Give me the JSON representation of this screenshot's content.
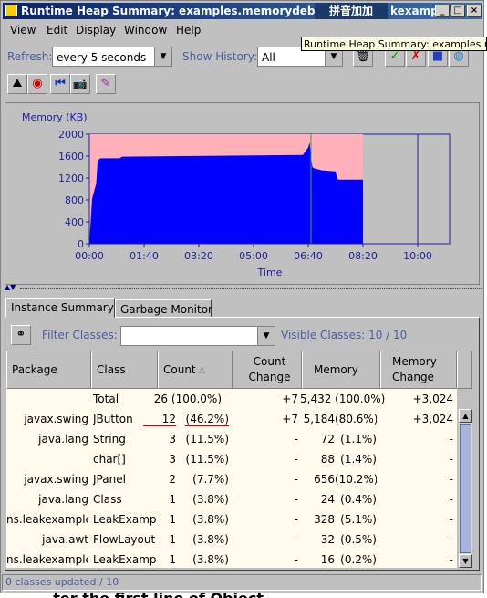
{
  "window": {
    "title": "Runtime Heap Summary: examples.memorydebugger.a",
    "title_tail": "kexamp..."
  },
  "ime_text": "拼音加加",
  "tooltip": "Runtime Heap Summary: examples.memor",
  "menu": [
    "View",
    "Edit",
    "Display",
    "Window",
    "Help"
  ],
  "toolbar": {
    "refresh_label": "Refresh:",
    "refresh_value": "every 5 seconds",
    "history_label": "Show History:",
    "history_value": "All"
  },
  "chart_data": {
    "type": "area",
    "ylabel": "Memory (KB)",
    "xlabel": "Time",
    "ylim": [
      0,
      2000
    ],
    "xlim_minutes": [
      0,
      12
    ],
    "yticks": [
      "0",
      "400",
      "800",
      "1200",
      "1600",
      "2000"
    ],
    "xticks": [
      "00:00",
      "01:40",
      "03:20",
      "05:00",
      "06:40",
      "08:20",
      "10:00"
    ],
    "series": [
      {
        "role": "total",
        "color": "#ffb0b8",
        "x": [
          0,
          10
        ],
        "values": [
          2000,
          2000
        ]
      },
      {
        "role": "used",
        "color": "#0000ff",
        "x": [
          0,
          0.1,
          0.25,
          0.3,
          0.35,
          0.4,
          1.1,
          1.2,
          7.8,
          8.0,
          8.05,
          8.1,
          8.15,
          8.2,
          8.5,
          9.0,
          9.05,
          9.1,
          10
        ],
        "values": [
          0,
          820,
          1100,
          1500,
          1540,
          1560,
          1560,
          1590,
          1620,
          1760,
          1850,
          1600,
          1400,
          1380,
          1340,
          1320,
          1200,
          1170,
          1170
        ]
      }
    ],
    "marker_x_minutes": 8.1,
    "grid": false
  },
  "tabs": [
    "Instance Summary",
    "Garbage Monitor"
  ],
  "filter": {
    "label": "Filter Classes:",
    "value": "",
    "visible_label": "Visible Classes:  10 / 10"
  },
  "columns": [
    "Package",
    "Class",
    "Count",
    "Count Change",
    "Memory",
    "Memory Change"
  ],
  "sort_glyph": "△",
  "total_row": {
    "label": "Total",
    "count": "26  (100.0%)",
    "count_change": "+7",
    "memory": "5,432  (100.0%)",
    "memory_change": "+3,024"
  },
  "rows": [
    {
      "package": "javax.swing",
      "class": "JButton",
      "count": "12",
      "count_pct": "(46.2%)",
      "count_change": "+7",
      "memory": "5,184",
      "memory_pct": "(80.6%)",
      "memory_change": "+3,024"
    },
    {
      "package": "java.lang",
      "class": "String",
      "count": "3",
      "count_pct": "(11.5%)",
      "count_change": "-",
      "memory": "72",
      "memory_pct": "(1.1%)",
      "memory_change": "-"
    },
    {
      "package": "",
      "class": "char[]",
      "count": "3",
      "count_pct": "(11.5%)",
      "count_change": "-",
      "memory": "88",
      "memory_pct": "(1.4%)",
      "memory_change": "-"
    },
    {
      "package": "javax.swing",
      "class": "JPanel",
      "count": "2",
      "count_pct": "(7.7%)",
      "count_change": "-",
      "memory": "656",
      "memory_pct": "(10.2%)",
      "memory_change": "-"
    },
    {
      "package": "java.lang",
      "class": "Class",
      "count": "1",
      "count_pct": "(3.8%)",
      "count_change": "-",
      "memory": "24",
      "memory_pct": "(0.4%)",
      "memory_change": "-"
    },
    {
      "package": "ns.leakexample",
      "class": "LeakExamp",
      "count": "1",
      "count_pct": "(3.8%)",
      "count_change": "-",
      "memory": "328",
      "memory_pct": "(5.1%)",
      "memory_change": "-"
    },
    {
      "package": "java.awt",
      "class": "FlowLayout",
      "count": "1",
      "count_pct": "(3.8%)",
      "count_change": "-",
      "memory": "32",
      "memory_pct": "(0.5%)",
      "memory_change": "-"
    },
    {
      "package": "ns.leakexample",
      "class": "LeakExamp",
      "count": "1",
      "count_pct": "(3.8%)",
      "count_change": "-",
      "memory": "16",
      "memory_pct": "(0.2%)",
      "memory_change": "-"
    }
  ],
  "status": "0 classes updated / 10",
  "below_text": "...ter the first line of Object..."
}
